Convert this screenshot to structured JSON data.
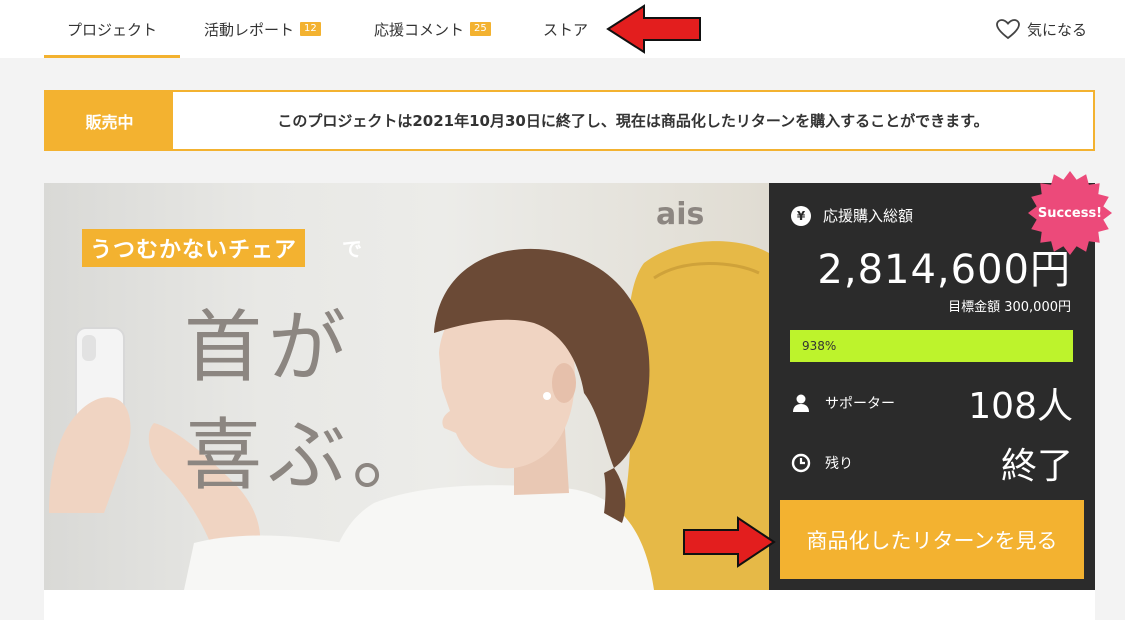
{
  "nav": {
    "tabs": [
      {
        "label": "プロジェクト"
      },
      {
        "label": "活動レポート",
        "badge": "12"
      },
      {
        "label": "応援コメント",
        "badge": "25"
      },
      {
        "label": "ストア"
      }
    ],
    "favorite_label": "気になる"
  },
  "notice": {
    "label": "販売中",
    "text": "このプロジェクトは2021年10月30日に終了し、現在は商品化したリターンを購入することができます。"
  },
  "hero": {
    "tag": "うつむかないチェア",
    "tag_suffix": "で",
    "headline_line1": "首が",
    "headline_line2": "喜ぶ。",
    "logo": "ais"
  },
  "stats": {
    "total_label": "応援購入総額",
    "total_value": "2,814,600円",
    "goal_text": "目標金額 300,000円",
    "progress_percent": 938,
    "progress_label": "938%",
    "supporters_label": "サポーター",
    "supporters_value": "108人",
    "remaining_label": "残り",
    "remaining_value": "終了",
    "cta_label": "商品化したリターンを見る",
    "badge": "Success!"
  },
  "colors": {
    "accent": "#f3b230",
    "panel": "#2b2b2b",
    "progress": "#bdf32c",
    "success_badge": "#ec4a7a",
    "annotation_arrow": "#e31e1e"
  }
}
